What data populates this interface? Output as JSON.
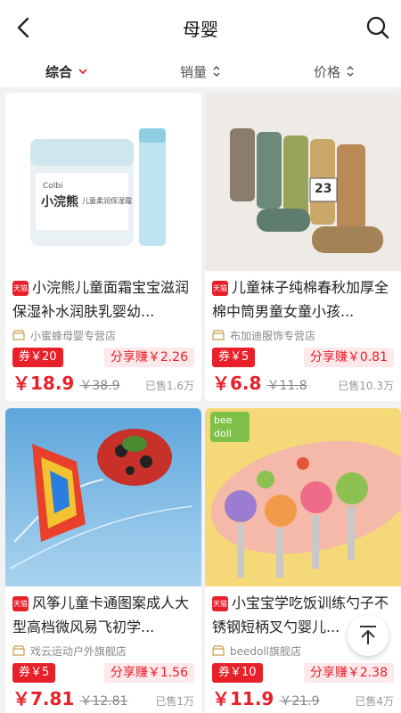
{
  "header": {
    "title": "母婴"
  },
  "sort": {
    "items": [
      {
        "label": "综合"
      },
      {
        "label": "销量"
      },
      {
        "label": "价格"
      }
    ]
  },
  "products": [
    {
      "name": "小浣熊儿童面霜宝宝滋润保湿补水润肤乳婴幼...",
      "badge": "天猫",
      "shop": "小蜜蜂母婴专营店",
      "coupon": "券￥20",
      "share": "分享赚￥2.26",
      "price": "￥18.9",
      "orig": "￥38.9",
      "sold": "已售1.6万",
      "img_text": [
        "Colbi",
        "小浣熊",
        "儿童柔润保湿霜"
      ]
    },
    {
      "name": "儿童袜子纯棉春秋加厚全棉中筒男童女童小孩...",
      "badge": "天猫",
      "shop": "布加迪服饰专营店",
      "coupon": "券￥5",
      "share": "分享赚￥0.81",
      "price": "￥6.8",
      "orig": "￥11.8",
      "sold": "已售10.3万",
      "img_text": [
        "23"
      ]
    },
    {
      "name": "风筝儿童卡通图案成人大型高档微风易飞初学...",
      "badge": "天猫",
      "shop": "戏云运动户外旗舰店",
      "coupon": "券￥5",
      "share": "分享赚￥1.56",
      "price": "￥7.81",
      "orig": "￥12.81",
      "sold": "已售1万",
      "img_text": []
    },
    {
      "name": "小宝宝学吃饭训练勺子不锈钢短柄叉勺婴儿...",
      "badge": "天猫",
      "shop": "beedoll旗舰店",
      "coupon": "券￥10",
      "share": "分享赚￥2.38",
      "price": "￥11.9",
      "orig": "￥21.9",
      "sold": "已售4万",
      "img_text": [
        "bee",
        "doll"
      ]
    }
  ],
  "icons": {
    "back": "back-arrow-icon",
    "search": "search-icon",
    "sort": "sort-arrows-icon",
    "shop": "store-icon",
    "top": "back-to-top-icon"
  }
}
